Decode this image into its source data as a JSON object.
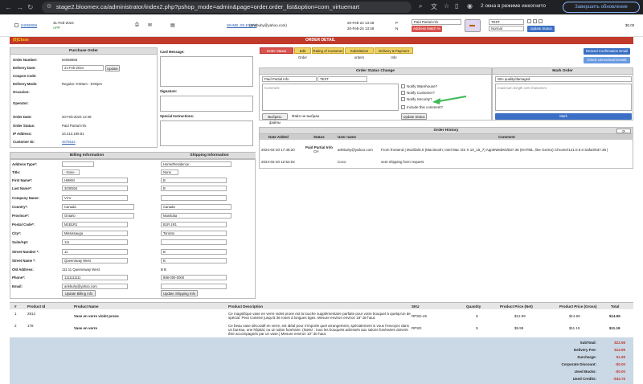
{
  "browser": {
    "url": "stage2.bloomex.ca/administrator/index2.php?pshop_mode=admin&page=order.order_list&option=com_virtuemart",
    "incognito_label": "2 окна в режиме инкогнито",
    "update_label": "Завершить обновление"
  },
  "top_row": {
    "order_link": "84058869",
    "date": "31-Feb-2024",
    "status_short": "APP",
    "customer_link": "WHMB JOLEGEW",
    "customer_email": "(arlebuhy@yahoo.com)",
    "date1": "20-Feb-24 13:48",
    "time1": "P",
    "date2": "20-Feb-24 13:48",
    "time2": "N",
    "status_select": "Paid Partial Info",
    "address_match": "Address Match %",
    "test_select": "TEST",
    "priority_select": "Normal",
    "update_status": "Update Status",
    "price": "$0.00"
  },
  "order_detail_bar": {
    "left": "(0)Close",
    "title": "ORDER DETAIL"
  },
  "purchase_order": {
    "title": "Purchase Order",
    "order_number_label": "Order Number:",
    "order_number": "84058869",
    "delivery_date_label": "Delivery Date:",
    "delivery_date": "21-Feb-2024",
    "update_btn": "Update",
    "coupon_label": "Coupon Code:",
    "delivery_mode_label": "Delivery Mode:",
    "delivery_mode": "Regular: 9:00am - 8:00pm",
    "occasion_label": "Occasion:",
    "operator_label": "Operator:",
    "order_date_label": "Order Date:",
    "order_date": "20-Feb-2024 12:48",
    "order_status_label": "Order Status:",
    "order_status": "Paid Partial Info",
    "ip_label": "IP Address:",
    "ip": "34.213.199.81",
    "customer_id_label": "Customer ID:",
    "customer_id": "4675532"
  },
  "side_boxes": {
    "card_message": "Card Message:",
    "signature": "Signature:",
    "special_instructions": "Special Instructions:"
  },
  "billing": {
    "title": "Billing Information",
    "address_type_label": "Address Type*:",
    "title_label": "Title:",
    "title_value": "- None -",
    "first_name_label": "First Name*:",
    "first_name": "HMKM",
    "last_name_label": "Last Name*:",
    "last_name": "3030934",
    "company_label": "Company Name:",
    "company": "VVV",
    "country_label": "Country*:",
    "country": "Canada",
    "province_label": "Province*:",
    "province": "Ontario",
    "postal_label": "Postal Code*:",
    "postal": "M1B1R1",
    "city_label": "City*:",
    "city": "Mississauga",
    "suite_label": "Suite/Apt:",
    "suite": "111",
    "street_number_label": "Street Number *:",
    "street_number": "11",
    "street_name_label": "Street Name *:",
    "street_name": "Queensway West",
    "old_address_label": "Old Address:",
    "old_address": "111 11 Queensway West",
    "phone_label": "Phone*:",
    "phone": "1111111111",
    "email_label": "Email:",
    "email": "arlebuhy@yahoo.com",
    "update_btn": "Update Billing Info"
  },
  "shipping": {
    "title": "Shipping Information",
    "address_type": "Home/Residence",
    "title_value": "None",
    "first_name": "B",
    "last_name": "B",
    "country": "Canada",
    "province": "Manitoba",
    "postal": "B1R 1R1",
    "city": "Toronto",
    "street_number": "B",
    "street_name": "B",
    "old_address": "B B",
    "phone": "888-000-0000",
    "update_btn": "Update Shipping Info"
  },
  "tabs": [
    {
      "label": "Order Status Change",
      "active": true
    },
    {
      "label": "Edit Order",
      "active": false
    },
    {
      "label": "Rating of Customer",
      "active": false
    },
    {
      "label": "Substitution orders",
      "active": false
    },
    {
      "label": "Delivery & Payment Info",
      "active": false
    }
  ],
  "right_buttons": {
    "resend": "Resend Confirmation Email",
    "check_unresolved": "Check Unresolved Emails"
  },
  "status_change": {
    "title": "Order Status Change",
    "status_select": "Paid Partial Info",
    "test_select": "TEST",
    "comment_placeholder": "Comment",
    "notify_warehouse": "Notify Warehouse?",
    "notify_customer": "Notify Customer?",
    "notify_security": "Notify Security?",
    "include_comment": "Include this comment?",
    "choose_file": "Выбрать файлы",
    "no_file": "Файл не выбран",
    "update_status": "Update Status"
  },
  "mark_order": {
    "title": "Mark Order",
    "select": "Wm quality/damaged",
    "placeholder": "maximum length 120 characters",
    "mark_btn": "Mark"
  },
  "history": {
    "title": "Order History",
    "columns": [
      "Date Added",
      "Status",
      "User name",
      "Comment"
    ],
    "rows": [
      {
        "date": "2024-02-20 17:48:20",
        "status": "Paid Partial Info",
        "status2": "CH",
        "user": "arlebuhy@yahoo.com",
        "comment": "From frontend | Mozilla/5.0 (Macintosh; Intel Mac OS X 10_15_7) AppleWebKit/537.36 (KHTML, like Gecko) Chrome/121.0.0.0 Safari/537.36 |"
      },
      {
        "date": "2024-02-20 12:54:02",
        "status": "",
        "status2": "",
        "user": "Coco",
        "comment": "sent shipping form request"
      }
    ]
  },
  "products": {
    "columns": [
      "#",
      "Product Id",
      "Product Name",
      "Product Description",
      "SKU",
      "Quantity",
      "Product Price (Net)",
      "Product Price (Gross)",
      "Total"
    ],
    "rows": [
      {
        "n": "1",
        "id": "2814",
        "name": "Vase en verre violet prune",
        "desc": "Ce magnifique vase en verre violet prune est la touche supplémentaire parfaite pour votre bouquet à quelqu'un de spécial. Peut contenir jusqu'à 36 roses à longues tiges. Mesure environ environ 18\" de haut.",
        "sku": "RPSD-45",
        "qty": "1",
        "net": "$12.99",
        "gross": "$14.55",
        "total": "$14.55"
      },
      {
        "n": "2",
        "id": "178",
        "name": "Vase en verre",
        "desc": "Ce beau vase décoratif en verre, est idéal pour n'importe quel arrangement, spécialement si vous l'envoyez dans un bureau, une hôpital, ou un salon funéraire. (Notez : tous les bouquets adressés aux salons funéraires doivent être accompagnés par un vase.) Mesure environ 10\" de haut.",
        "sku": "RPSD",
        "qty": "1",
        "net": "$9.99",
        "gross": "$11.19",
        "total": "$11.19"
      }
    ]
  },
  "totals": [
    {
      "label": "SubTotal:",
      "value": "$22.98"
    },
    {
      "label": "Delivery Fee:",
      "value": "$14.99"
    },
    {
      "label": "Surcharge:",
      "value": "$1.99"
    },
    {
      "label": "Corporate Discount:",
      "value": "-$0.00"
    },
    {
      "label": "Used Bucks:",
      "value": "-$0.00"
    },
    {
      "label": "Used Credits:",
      "value": "-$44.76"
    }
  ],
  "colors": {
    "accent_red": "#c0392b",
    "tab_yellow": "#f0d261",
    "blue_button": "#3b6fc5",
    "totals_bg": "#cbd8e6",
    "arrow_green": "#3cba54"
  }
}
